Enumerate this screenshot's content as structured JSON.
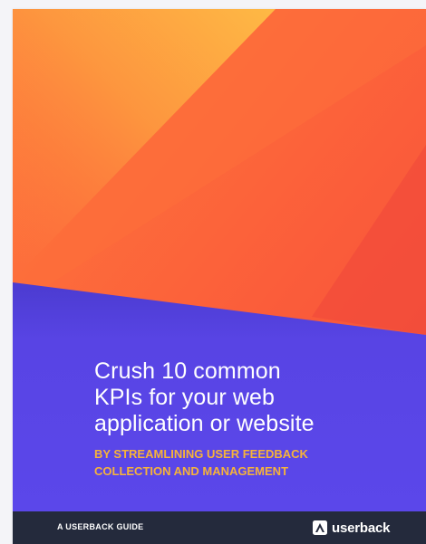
{
  "cover": {
    "title_lines": [
      "Crush 10 common",
      "KPIs for your web",
      "application or website"
    ],
    "subtitle_lines": [
      "BY STREAMLINING USER FEEDBACK",
      "COLLECTION AND MANAGEMENT"
    ]
  },
  "footer": {
    "guide_label": "A USERBACK GUIDE",
    "brand_name": "userback",
    "brand_icon": "userback-logo-icon"
  },
  "colors": {
    "orange_primary": "#fb6a3a",
    "orange_light": "#fdbd45",
    "purple_band": "#5b45e8",
    "footer_bg": "#242a3c",
    "subtitle": "#f6b33a"
  }
}
